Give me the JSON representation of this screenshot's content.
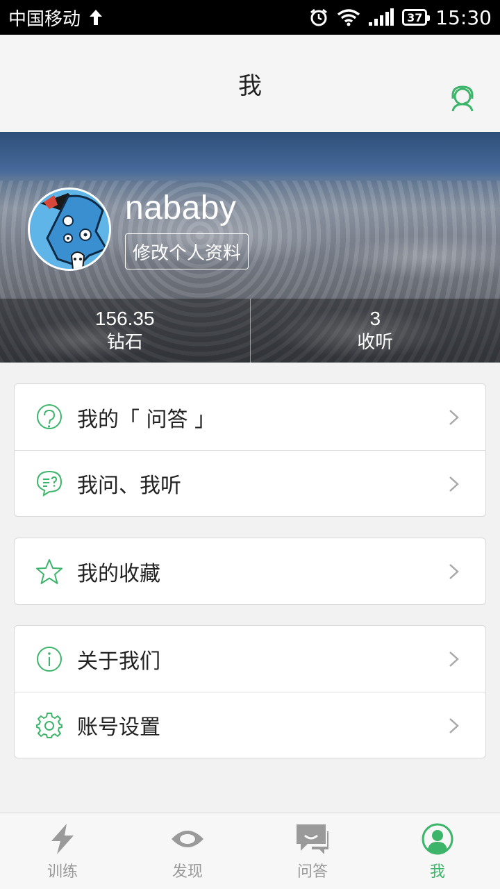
{
  "status_bar": {
    "carrier": "中国移动",
    "battery": "37",
    "time": "15:30"
  },
  "header": {
    "title": "我"
  },
  "profile": {
    "username": "nababy",
    "edit_label": "修改个人资料",
    "stats": [
      {
        "value": "156.35",
        "label": "钻石"
      },
      {
        "value": "3",
        "label": "收听"
      }
    ]
  },
  "menu": {
    "group1": [
      {
        "label": "我的「 问答 」",
        "icon": "qa-bubble-icon"
      },
      {
        "label": "我问、我听",
        "icon": "chat-question-icon"
      }
    ],
    "group2": [
      {
        "label": "我的收藏",
        "icon": "star-icon"
      }
    ],
    "group3": [
      {
        "label": "关于我们",
        "icon": "info-icon"
      },
      {
        "label": "账号设置",
        "icon": "gear-icon"
      }
    ]
  },
  "tabs": [
    {
      "label": "训练",
      "icon": "lightning-icon"
    },
    {
      "label": "发现",
      "icon": "eye-icon"
    },
    {
      "label": "问答",
      "icon": "chat-icon"
    },
    {
      "label": "我",
      "icon": "user-icon",
      "active": true
    }
  ],
  "colors": {
    "accent": "#3cb56a",
    "inactive": "#9a9a9a"
  }
}
